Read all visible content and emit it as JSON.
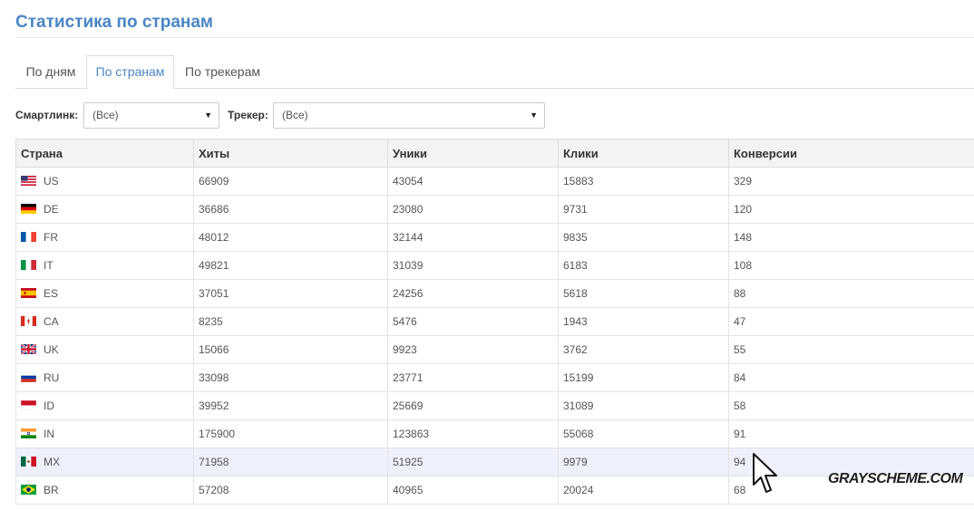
{
  "page": {
    "title": "Статистика по странам"
  },
  "tabs": [
    {
      "label": "По дням",
      "active": false
    },
    {
      "label": "По странам",
      "active": true
    },
    {
      "label": "По трекерам",
      "active": false
    }
  ],
  "filters": {
    "smartlink_label": "Смартлинк:",
    "smartlink_value": "(Все)",
    "tracker_label": "Трекер:",
    "tracker_value": "(Все)"
  },
  "table": {
    "headers": [
      "Страна",
      "Хиты",
      "Уники",
      "Клики",
      "Конверсии"
    ],
    "rows": [
      {
        "country": "US",
        "flag": "us-flag-icon",
        "hits": "66909",
        "uniques": "43054",
        "clicks": "15883",
        "conversions": "329"
      },
      {
        "country": "DE",
        "flag": "de-flag-icon",
        "hits": "36686",
        "uniques": "23080",
        "clicks": "9731",
        "conversions": "120"
      },
      {
        "country": "FR",
        "flag": "fr-flag-icon",
        "hits": "48012",
        "uniques": "32144",
        "clicks": "9835",
        "conversions": "148"
      },
      {
        "country": "IT",
        "flag": "it-flag-icon",
        "hits": "49821",
        "uniques": "31039",
        "clicks": "6183",
        "conversions": "108"
      },
      {
        "country": "ES",
        "flag": "es-flag-icon",
        "hits": "37051",
        "uniques": "24256",
        "clicks": "5618",
        "conversions": "88"
      },
      {
        "country": "CA",
        "flag": "ca-flag-icon",
        "hits": "8235",
        "uniques": "5476",
        "clicks": "1943",
        "conversions": "47"
      },
      {
        "country": "UK",
        "flag": "uk-flag-icon",
        "hits": "15066",
        "uniques": "9923",
        "clicks": "3762",
        "conversions": "55"
      },
      {
        "country": "RU",
        "flag": "ru-flag-icon",
        "hits": "33098",
        "uniques": "23771",
        "clicks": "15199",
        "conversions": "84"
      },
      {
        "country": "ID",
        "flag": "id-flag-icon",
        "hits": "39952",
        "uniques": "25669",
        "clicks": "31089",
        "conversions": "58"
      },
      {
        "country": "IN",
        "flag": "in-flag-icon",
        "hits": "175900",
        "uniques": "123863",
        "clicks": "55068",
        "conversions": "91"
      },
      {
        "country": "MX",
        "flag": "mx-flag-icon",
        "hits": "71958",
        "uniques": "51925",
        "clicks": "9979",
        "conversions": "94"
      },
      {
        "country": "BR",
        "flag": "br-flag-icon",
        "hits": "57208",
        "uniques": "40965",
        "clicks": "20024",
        "conversions": "68"
      }
    ]
  },
  "watermark": "GRAYSCHEME.COM",
  "colors": {
    "accent": "#4a86c5",
    "header_bg": "#f3f3f3",
    "hover_row": "#eef0fb"
  }
}
